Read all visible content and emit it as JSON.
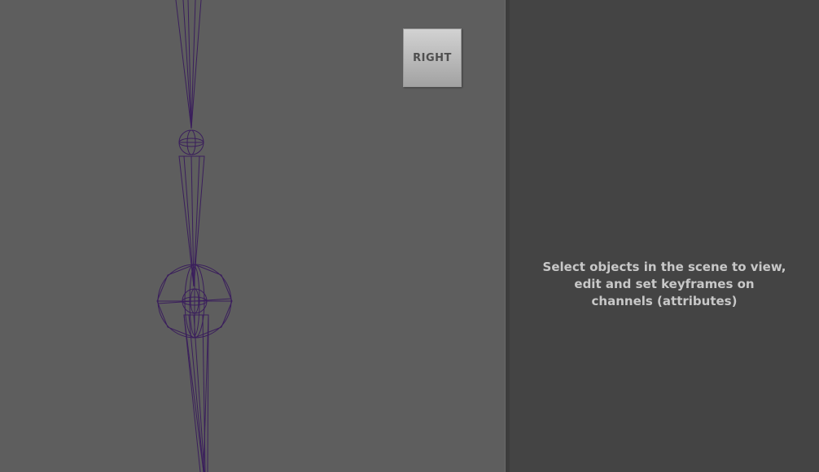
{
  "viewport": {
    "view_cube": {
      "label": "RIGHT"
    },
    "wireframe_color": "#3a1e5c"
  },
  "channel_box": {
    "empty_message": "Select objects in the scene to view, edit and set keyframes on channels (attributes)"
  }
}
